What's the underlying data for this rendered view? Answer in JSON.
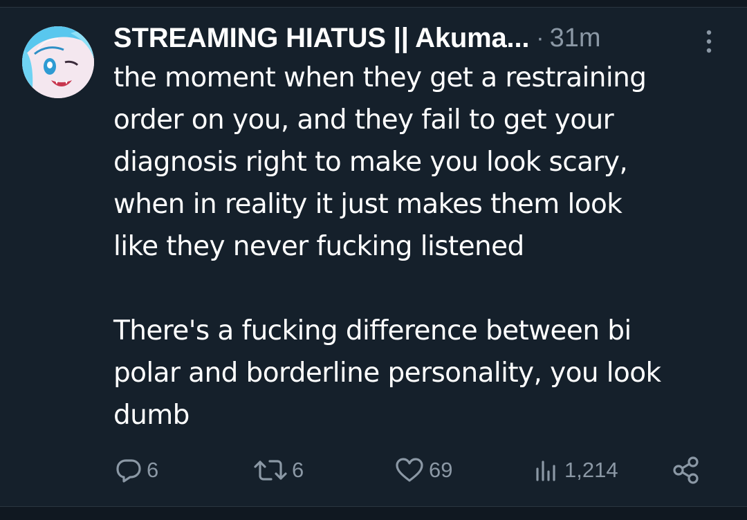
{
  "tweet": {
    "display_name": "STREAMING HIATUS || Akuma...",
    "separator": "·",
    "time": "31m",
    "paragraphs": [
      "the moment when they get a restraining\norder on you, and they fail to get your\ndiagnosis right to make you look scary,\nwhen in reality it just makes them look\nlike they never fucking listened",
      "There's a fucking difference between bi\npolar and borderline personality, you look\ndumb"
    ]
  },
  "actions": {
    "replies": "6",
    "retweets": "6",
    "likes": "69",
    "views": "1,214"
  },
  "icons": {
    "more": "more-vertical-icon",
    "reply": "reply-icon",
    "retweet": "retweet-icon",
    "like": "heart-icon",
    "views": "views-icon",
    "share": "share-icon"
  },
  "colors": {
    "background": "#15202b",
    "text": "#ffffff",
    "muted": "#8b98a5"
  }
}
